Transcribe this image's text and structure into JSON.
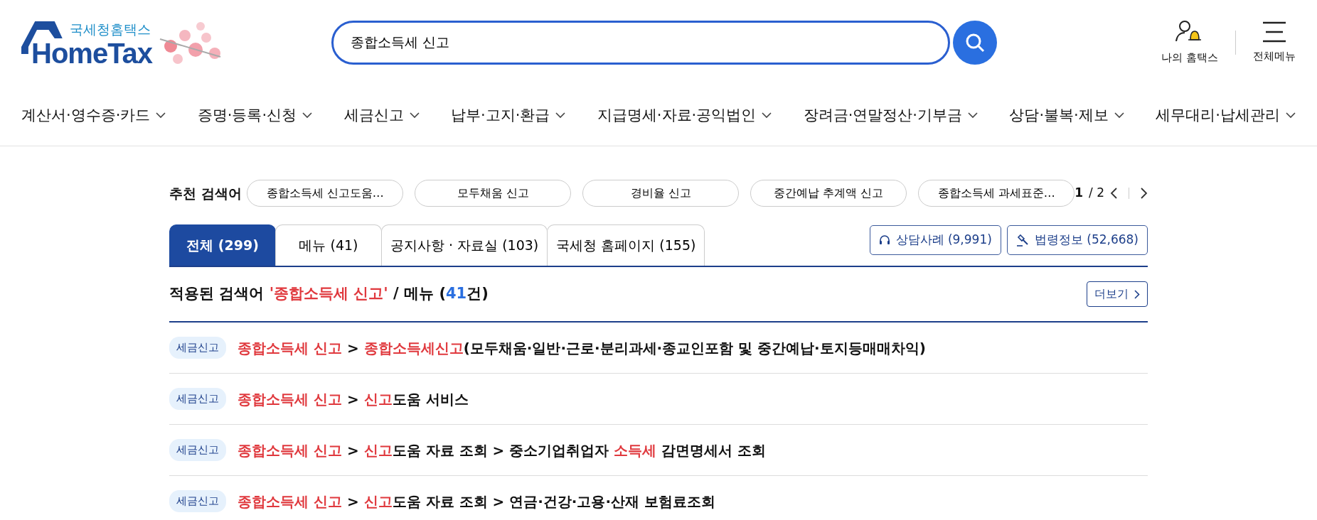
{
  "header": {
    "logo": {
      "subtitle": "국세청홈택스",
      "title": "HomeTax"
    },
    "search": {
      "value": "종합소득세 신고"
    },
    "my_hometax": "나의 홈택스",
    "all_menu": "전체메뉴"
  },
  "nav": [
    "계산서·영수증·카드",
    "증명·등록·신청",
    "세금신고",
    "납부·고지·환급",
    "지급명세·자료·공익법인",
    "장려금·연말정산·기부금",
    "상담·불복·제보",
    "세무대리·납세관리"
  ],
  "suggestions": {
    "label": "추천 검색어",
    "items": [
      "종합소득세 신고도움…",
      "모두채움 신고",
      "경비율 신고",
      "중간예납 추계액 신고",
      "종합소득세 과세표준…"
    ],
    "page": "1",
    "total": "/ 2"
  },
  "tabs": [
    {
      "label": "전체 (299)",
      "selected": true
    },
    {
      "label": "메뉴 (41)",
      "selected": false
    },
    {
      "label": "공지사항 · 자료실 (103)",
      "selected": false
    },
    {
      "label": "국세청 홈페이지 (155)",
      "selected": false
    }
  ],
  "side_buttons": [
    {
      "kind": "headset",
      "label": "상담사례 (9,991)"
    },
    {
      "kind": "gavel",
      "label": "법령정보 (52,668)"
    }
  ],
  "result_heading": {
    "prefix": "적용된 검색어 ",
    "term": "'종합소득세 신고'",
    "middle": " / 메뉴 (",
    "count": "41",
    "suffix": "건)",
    "more": "더보기"
  },
  "results": [
    {
      "tag": "세금신고",
      "segments": [
        {
          "text": "종합소득세 신고",
          "highlight": true
        },
        {
          "text": " > ",
          "highlight": false
        },
        {
          "text": "종합소득세신고",
          "highlight": true
        },
        {
          "text": "(모두채움·일반·근로·분리과세·종교인포함 및 중간예납·토지등매매차익)",
          "highlight": false
        }
      ]
    },
    {
      "tag": "세금신고",
      "segments": [
        {
          "text": "종합소득세 신고",
          "highlight": true
        },
        {
          "text": " > ",
          "highlight": false
        },
        {
          "text": "신고",
          "highlight": true
        },
        {
          "text": "도움 서비스",
          "highlight": false
        }
      ]
    },
    {
      "tag": "세금신고",
      "segments": [
        {
          "text": "종합소득세 신고",
          "highlight": true
        },
        {
          "text": " > ",
          "highlight": false
        },
        {
          "text": "신고",
          "highlight": true
        },
        {
          "text": "도움 자료 조회 > 중소기업취업자 ",
          "highlight": false
        },
        {
          "text": "소득세",
          "highlight": true
        },
        {
          "text": " 감면명세서 조회",
          "highlight": false
        }
      ]
    },
    {
      "tag": "세금신고",
      "segments": [
        {
          "text": "종합소득세 신고",
          "highlight": true
        },
        {
          "text": " > ",
          "highlight": false
        },
        {
          "text": "신고",
          "highlight": true
        },
        {
          "text": "도움 자료 조회 > 연금·건강·고용·산재 보험료조회",
          "highlight": false
        }
      ]
    }
  ]
}
